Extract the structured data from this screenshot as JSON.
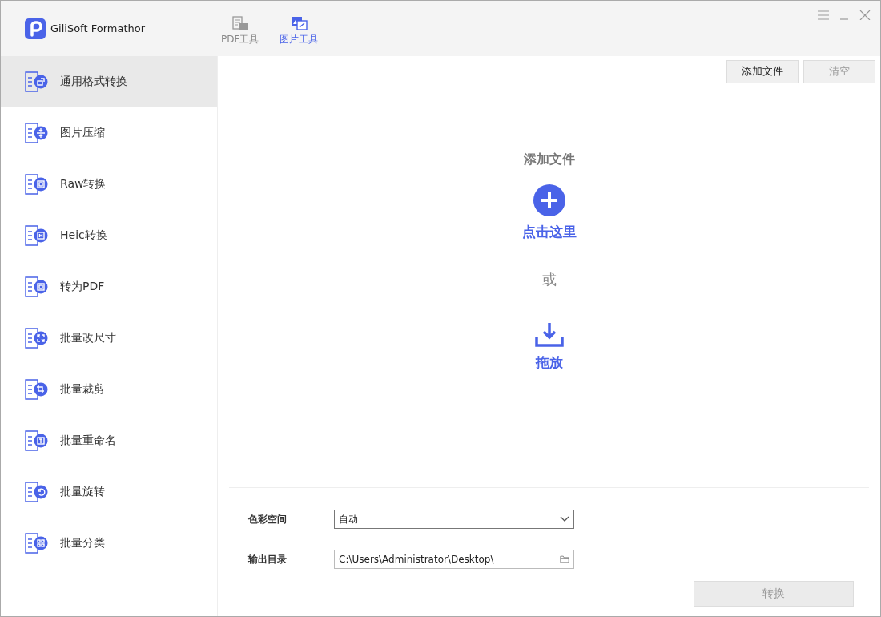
{
  "app": {
    "title": "GiliSoft Formathor"
  },
  "tabs": [
    {
      "label": "PDF工具",
      "selected": false,
      "kind": "pdf"
    },
    {
      "label": "图片工具",
      "selected": true,
      "kind": "image"
    }
  ],
  "sidebar": {
    "items": [
      {
        "label": "通用格式转换",
        "selected": true,
        "kind": "convert"
      },
      {
        "label": "图片压缩",
        "selected": false,
        "kind": "compress"
      },
      {
        "label": "Raw转换",
        "selected": false,
        "kind": "raw"
      },
      {
        "label": "Heic转换",
        "selected": false,
        "kind": "heic"
      },
      {
        "label": "转为PDF",
        "selected": false,
        "kind": "pdf"
      },
      {
        "label": "批量改尺寸",
        "selected": false,
        "kind": "resize"
      },
      {
        "label": "批量裁剪",
        "selected": false,
        "kind": "crop"
      },
      {
        "label": "批量重命名",
        "selected": false,
        "kind": "rename"
      },
      {
        "label": "批量旋转",
        "selected": false,
        "kind": "rotate"
      },
      {
        "label": "批量分类",
        "selected": false,
        "kind": "classify"
      }
    ]
  },
  "toolbar": [
    {
      "label": "添加文件",
      "disabled": false
    },
    {
      "label": "清空",
      "disabled": true
    }
  ],
  "dropzone": {
    "title": "添加文件",
    "click_label": "点击这里",
    "or_label": "或",
    "drop_label": "拖放"
  },
  "settings": {
    "color_space": {
      "label": "色彩空间",
      "value": "自动"
    },
    "output_dir": {
      "label": "输出目录",
      "value": "C:\\Users\\Administrator\\Desktop\\"
    }
  },
  "convert_button": {
    "label": "转换",
    "disabled": true
  }
}
